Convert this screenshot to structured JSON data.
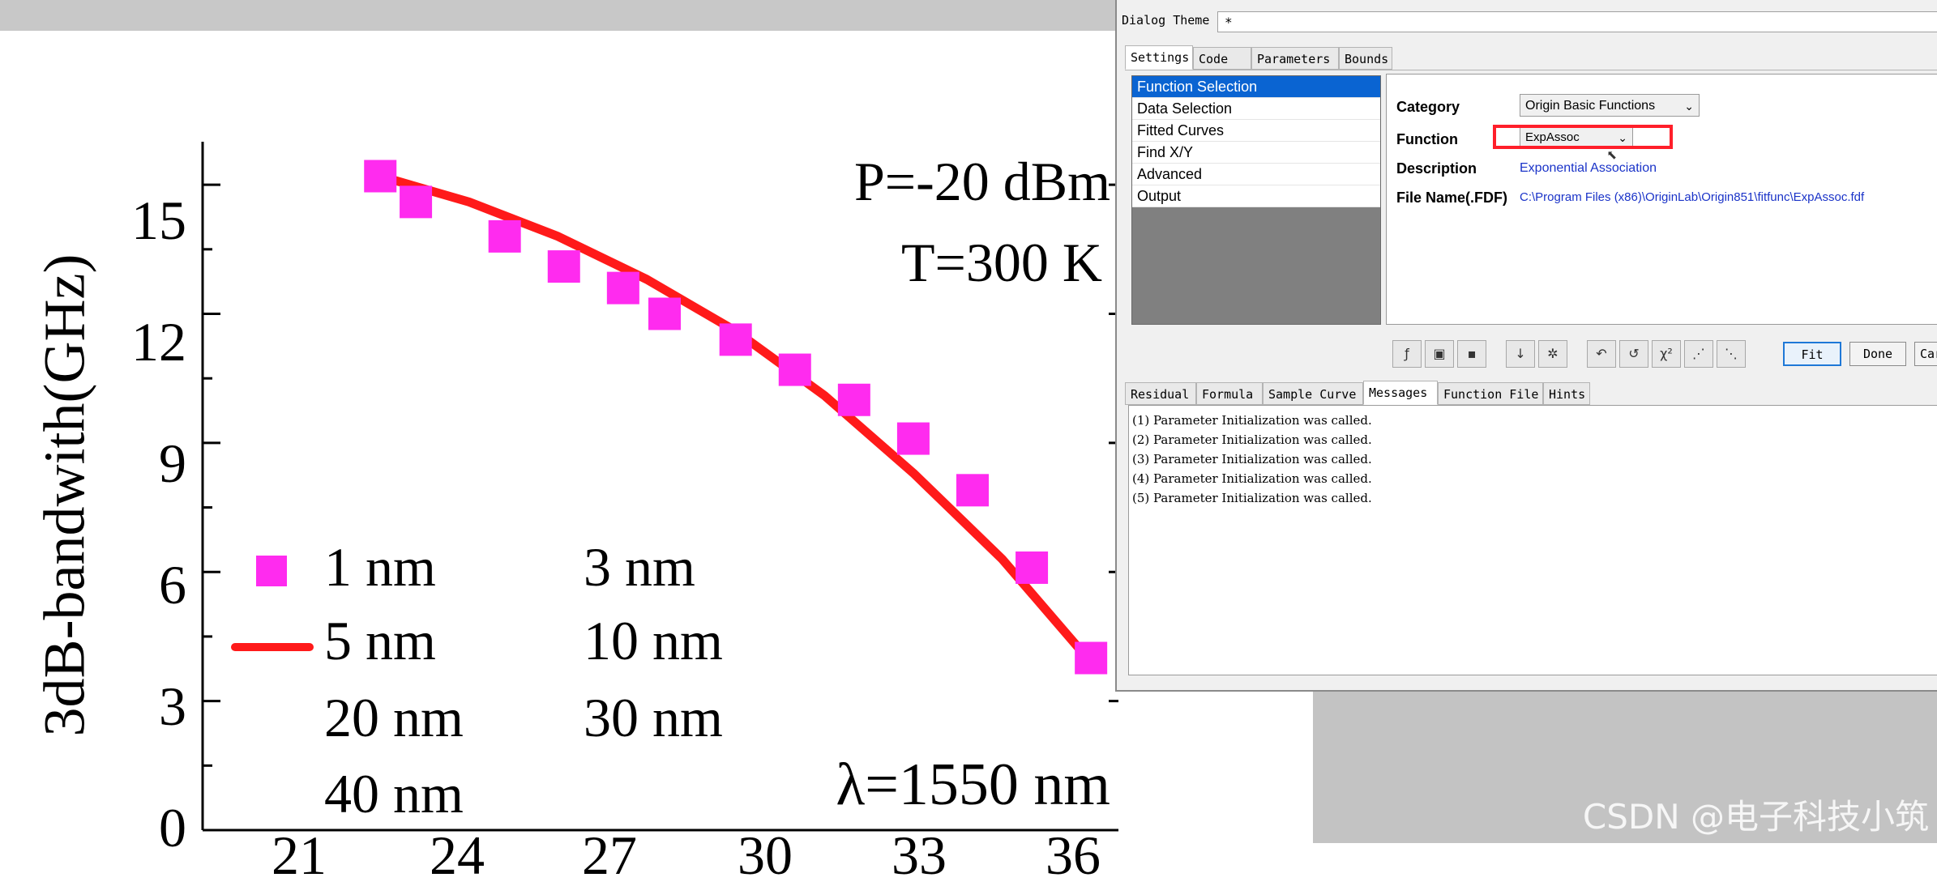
{
  "plot": {
    "y_label": "3dB-bandwith(GHz)",
    "y_ticks": [
      "15",
      "12",
      "9",
      "6",
      "3",
      "0"
    ],
    "x_ticks": [
      "21",
      "24",
      "27",
      "30",
      "33",
      "36"
    ],
    "annotation_power": "P=-20 dBm",
    "annotation_temp": "T=300 K",
    "annotation_lambda": "λ=1550 nm",
    "legend": [
      "1 nm",
      "3 nm",
      "5 nm",
      "10 nm",
      "20 nm",
      "30 nm",
      "40 nm"
    ],
    "marker_color": "#ff2bef",
    "line_color": "#ff1a1a"
  },
  "chart_data": {
    "type": "scatter",
    "ylabel": "3dB-bandwith(GHz)",
    "ylim": [
      0,
      16
    ],
    "xlim": [
      21,
      36.6
    ],
    "series": [
      {
        "name": "1 nm",
        "type": "scatter",
        "x": [
          24,
          24.6,
          26.1,
          27.1,
          28.1,
          28.8,
          30.0,
          31.0,
          32.0,
          33.0,
          34.0,
          35.0,
          36.0
        ],
        "y": [
          15.2,
          14.6,
          13.8,
          13.1,
          12.6,
          12.0,
          11.4,
          10.7,
          10.0,
          9.1,
          7.9,
          6.1,
          4.0
        ]
      },
      {
        "name": "5 nm",
        "type": "line",
        "x": [
          24.0,
          25.5,
          27.0,
          28.5,
          30.0,
          31.5,
          33.0,
          34.5,
          36.0
        ],
        "y": [
          15.2,
          14.6,
          13.8,
          12.8,
          11.6,
          10.1,
          8.3,
          6.3,
          3.9
        ]
      }
    ]
  },
  "dialog": {
    "theme_label": "Dialog Theme",
    "theme_value": "*",
    "tabs_top": [
      "Settings",
      "Code",
      "Parameters",
      "Bounds"
    ],
    "tree_items": [
      "Function Selection",
      "Data Selection",
      "Fitted Curves",
      "Find X/Y",
      "Advanced",
      "Output"
    ],
    "category_label": "Category",
    "category_value": "Origin Basic Functions",
    "function_label": "Function",
    "function_value": "ExpAssoc",
    "description_label": "Description",
    "description_value": "Exponential Association",
    "file_label": "File Name(.FDF)",
    "file_value": "C:\\Program Files (x86)\\OriginLab\\Origin851\\fitfunc\\ExpAssoc.fdf",
    "btn_fit": "Fit",
    "btn_done": "Done",
    "btn_cancel": "Car",
    "tabs_bottom": [
      "Residual",
      "Formula",
      "Sample Curve",
      "Messages",
      "Function File",
      "Hints"
    ],
    "messages": [
      "(1) Parameter Initialization was called.",
      "(2) Parameter Initialization was called.",
      "(3) Parameter Initialization was called.",
      "(4) Parameter Initialization was called.",
      "(5) Parameter Initialization was called."
    ]
  },
  "watermark": "CSDN @电子科技小筑"
}
